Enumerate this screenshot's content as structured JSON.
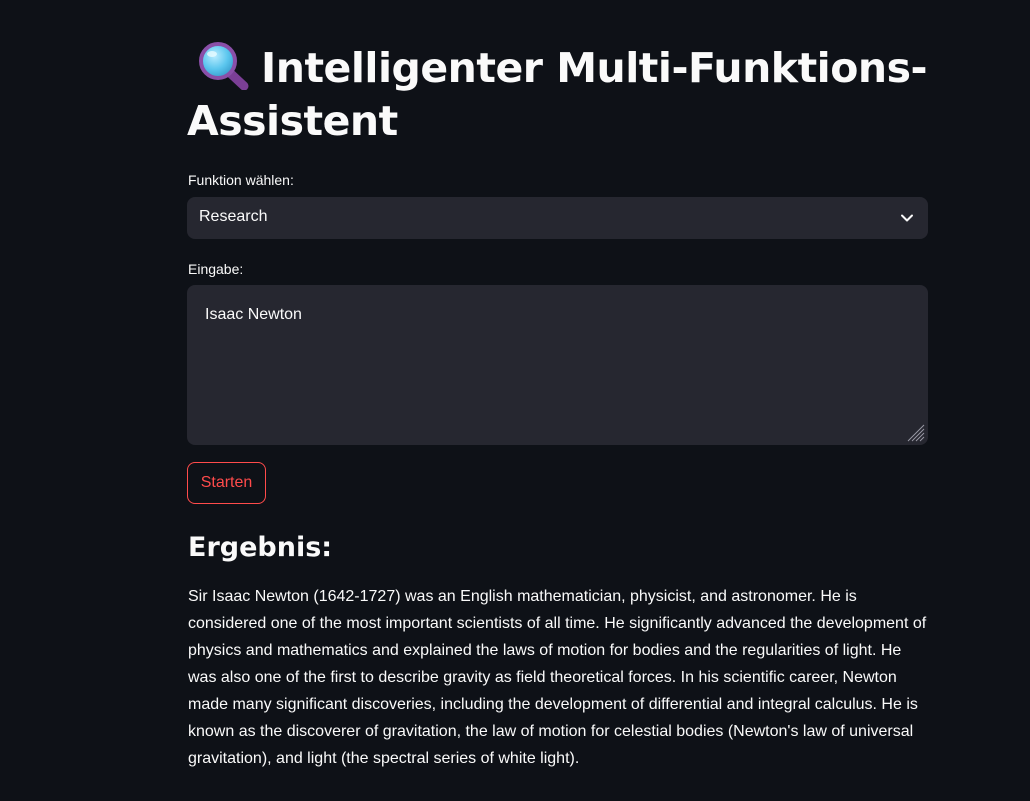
{
  "app": {
    "title_icon": "magnifying-glass-icon",
    "title": "Intelligenter Multi-Funktions-Assistent"
  },
  "function_select": {
    "label": "Funktion wählen:",
    "selected": "Research",
    "icon": "chevron-down-icon"
  },
  "input": {
    "label": "Eingabe:",
    "value": "Isaac Newton"
  },
  "actions": {
    "start_label": "Starten"
  },
  "result": {
    "heading": "Ergebnis:",
    "text": "Sir Isaac Newton (1642-1727) was an English mathematician, physicist, and astronomer. He is considered one of the most important scientists of all time. He significantly advanced the development of physics and mathematics and explained the laws of motion for bodies and the regularities of light. He was also one of the first to describe gravity as field theoretical forces. In his scientific career, Newton made many significant discoveries, including the development of differential and integral calculus. He is known as the discoverer of gravitation, the law of motion for celestial bodies (Newton's law of universal gravitation), and light (the spectral series of white light)."
  },
  "colors": {
    "background": "#0e1117",
    "input_background": "#262730",
    "accent": "#ff4b4b",
    "text": "#fafafa"
  }
}
